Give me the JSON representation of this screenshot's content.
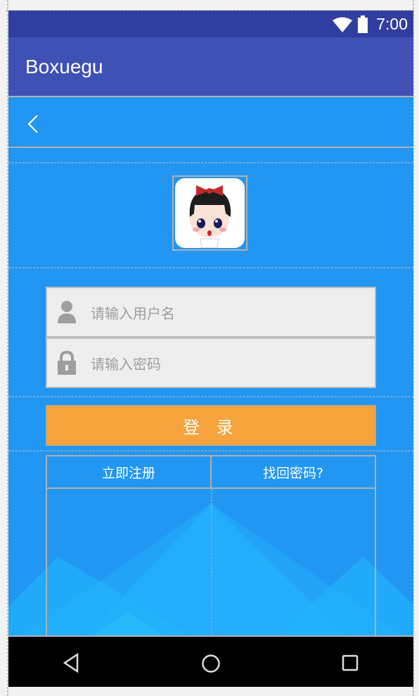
{
  "status_bar": {
    "time": "7:00",
    "icons": [
      "wifi-icon",
      "battery-icon"
    ]
  },
  "app_bar": {
    "title": "Boxuegu"
  },
  "title_bar": {
    "back_icon": "chevron-left-icon"
  },
  "login": {
    "avatar": "cartoon-girl-avatar",
    "username": {
      "placeholder": "请输入用户名",
      "value": "",
      "icon": "user-icon"
    },
    "password": {
      "placeholder": "请输入密码",
      "value": "",
      "icon": "lock-icon"
    },
    "login_label": "登 录",
    "register_label": "立即注册",
    "forgot_label": "找回密码?"
  },
  "colors": {
    "status": "#303F9F",
    "appbar": "#3F51B5",
    "content": "#2196F3",
    "login_button": "#F5A33D"
  },
  "nav_bar": {
    "icons": [
      "back-icon",
      "home-icon",
      "recents-icon"
    ]
  }
}
